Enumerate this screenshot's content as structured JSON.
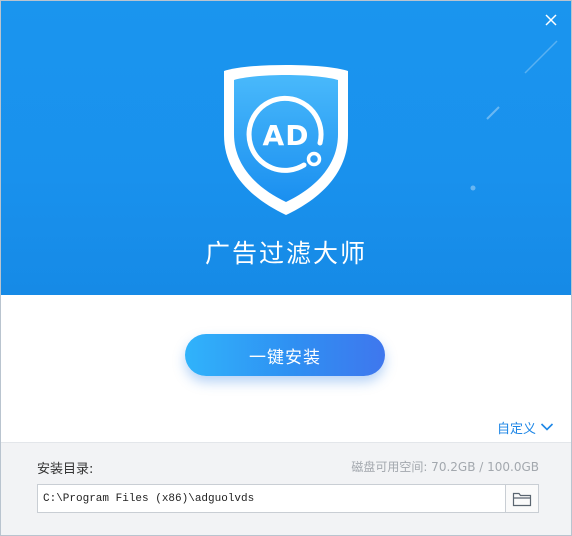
{
  "window": {
    "close_icon": "close-icon"
  },
  "header": {
    "app_name": "广告过滤大师",
    "logo_text": "AD",
    "logo_icon": "shield-ad-logo-icon"
  },
  "main": {
    "install_button_label": "一键安装",
    "customize_label": "自定义",
    "customize_icon": "chevron-down-icon"
  },
  "footer": {
    "install_dir_label": "安装目录:",
    "disk_space_text": "磁盘可用空间: 70.2GB / 100.0GB",
    "install_path": "C:\\Program Files (x86)\\adguolvds",
    "browse_icon": "folder-icon"
  },
  "colors": {
    "header_blue": "#1991ed",
    "button_gradient_start": "#30b3fb",
    "button_gradient_end": "#3f77ee",
    "link_blue": "#1d86e6",
    "footer_bg": "#f2f3f5"
  }
}
